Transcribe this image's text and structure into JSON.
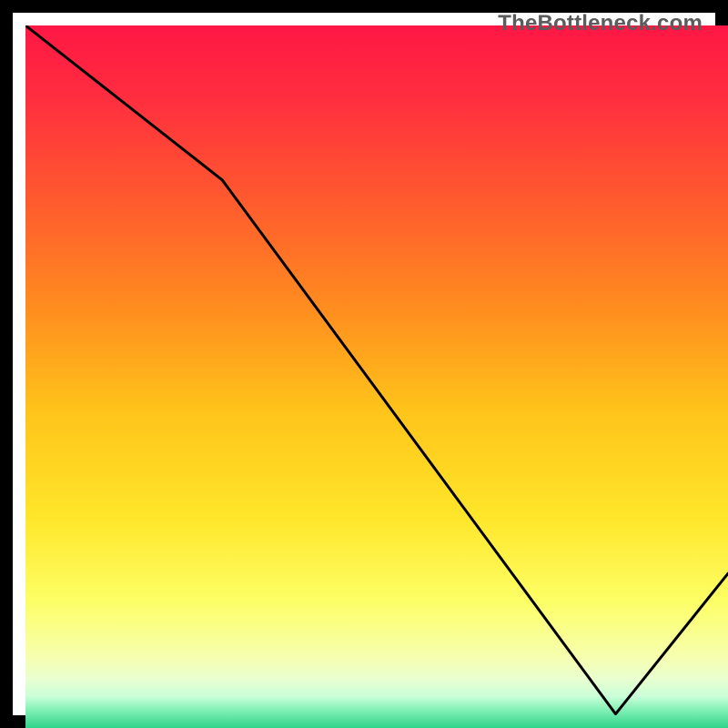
{
  "watermark": "TheBottleneck.com",
  "annotation_text": "",
  "chart_data": {
    "type": "line",
    "title": "",
    "xlabel": "",
    "ylabel": "",
    "xlim": [
      0,
      100
    ],
    "ylim": [
      0,
      100
    ],
    "x": [
      0,
      28,
      84,
      100
    ],
    "values": [
      100,
      78,
      2,
      22
    ],
    "gradient_stops": [
      {
        "offset": 0.0,
        "color": "#ff1744"
      },
      {
        "offset": 0.1,
        "color": "#ff2d3f"
      },
      {
        "offset": 0.25,
        "color": "#ff5a2e"
      },
      {
        "offset": 0.4,
        "color": "#ff8c1f"
      },
      {
        "offset": 0.55,
        "color": "#ffc41a"
      },
      {
        "offset": 0.7,
        "color": "#ffe62a"
      },
      {
        "offset": 0.82,
        "color": "#fdff66"
      },
      {
        "offset": 0.9,
        "color": "#f6ffb0"
      },
      {
        "offset": 0.93,
        "color": "#e9ffcf"
      },
      {
        "offset": 0.955,
        "color": "#c9ffd8"
      },
      {
        "offset": 0.975,
        "color": "#7ff0b4"
      },
      {
        "offset": 1.0,
        "color": "#2fd38a"
      }
    ],
    "annotation": {
      "x": 82,
      "y": 3,
      "label": ""
    }
  }
}
